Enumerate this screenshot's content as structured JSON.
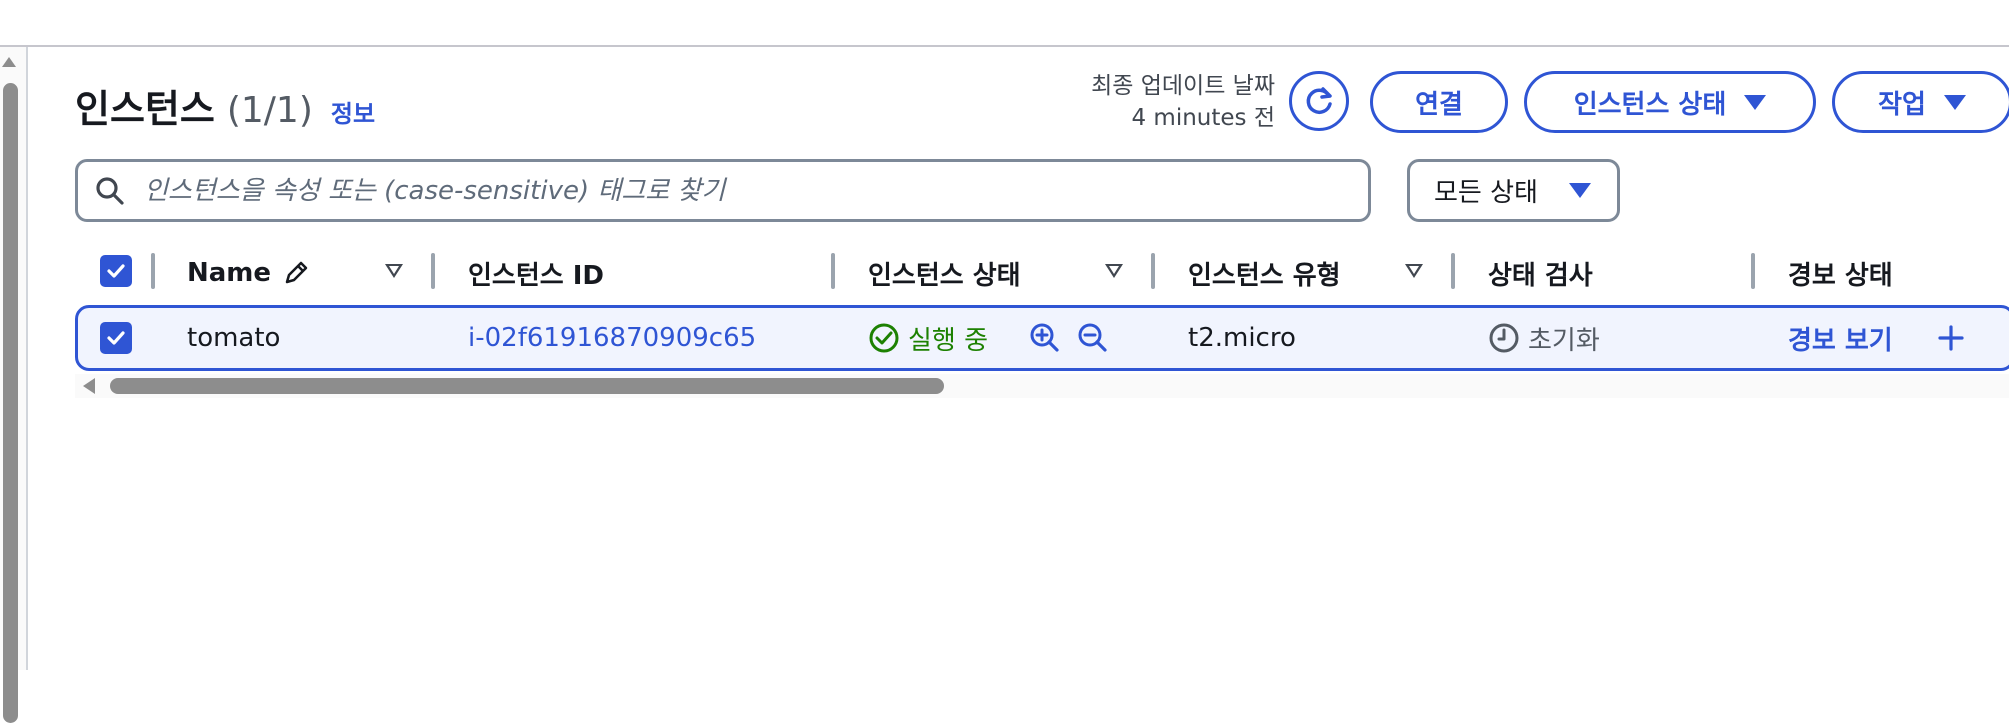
{
  "header": {
    "title": "인스턴스",
    "count": "(1/1)",
    "info_link": "정보",
    "last_updated_label": "최종 업데이트 날짜",
    "last_updated_value": "4 minutes 전"
  },
  "actions": {
    "connect": "연결",
    "instance_state": "인스턴스 상태",
    "actions": "작업"
  },
  "search": {
    "placeholder": "인스턴스을 속성 또는 (case-sensitive) 태그로 찾기"
  },
  "filter": {
    "selected": "모든 상태"
  },
  "table": {
    "columns": {
      "name": "Name",
      "instance_id": "인스턴스 ID",
      "instance_state": "인스턴스 상태",
      "instance_type": "인스턴스 유형",
      "status_check": "상태 검사",
      "alarm_status": "경보 상태"
    },
    "rows": [
      {
        "name": "tomato",
        "instance_id": "i-02f61916870909c65",
        "state": "실행 중",
        "type": "t2.micro",
        "status_check": "초기화",
        "alarm_link": "경보 보기",
        "selected": true
      }
    ]
  },
  "colors": {
    "accent": "#2f55d4",
    "running": "#1d8102",
    "border": "#7d8998",
    "row_bg": "#f1f4fe"
  },
  "icons": [
    "refresh-icon",
    "search-icon",
    "pencil-icon",
    "check-circle-icon",
    "zoom-in-icon",
    "zoom-out-icon",
    "clock-icon",
    "plus-icon",
    "caret-down-icon",
    "checkbox-checked-icon"
  ]
}
